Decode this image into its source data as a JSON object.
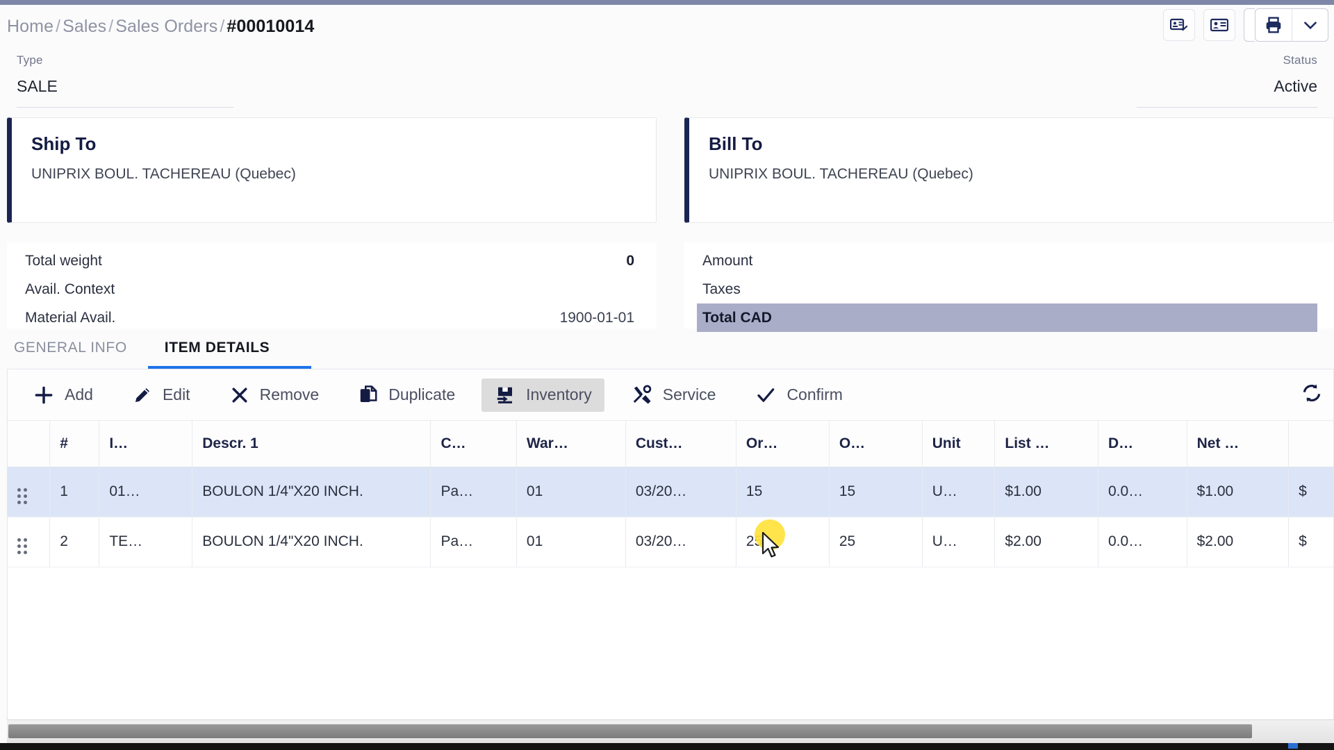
{
  "breadcrumb": {
    "items": [
      "Home",
      "Sales",
      "Sales Orders"
    ],
    "current": "#00010014",
    "separator": "/"
  },
  "header_actions": {
    "signature_button": "signature-icon",
    "contact_card_button": "contact-card-icon",
    "print_button": "printer-icon",
    "print_dropdown": "chevron-down-icon"
  },
  "fields": {
    "type_label": "Type",
    "type_value": "SALE",
    "status_label": "Status",
    "status_value": "Active"
  },
  "ship_to": {
    "title": "Ship To",
    "address": "UNIPRIX BOUL. TACHEREAU (Quebec)"
  },
  "bill_to": {
    "title": "Bill To",
    "address": "UNIPRIX BOUL. TACHEREAU (Quebec)"
  },
  "left_summary": {
    "rows": [
      {
        "label": "Total weight",
        "value": "0"
      },
      {
        "label": "Avail. Context",
        "value": ""
      },
      {
        "label": "Material Avail.",
        "value": "1900-01-01"
      }
    ]
  },
  "right_summary": {
    "rows": [
      {
        "label": "Amount",
        "value": ""
      },
      {
        "label": "Taxes",
        "value": ""
      },
      {
        "label": "Total CAD",
        "value": ""
      }
    ],
    "highlight_color": "#a9adc8"
  },
  "tabs": [
    {
      "label": "GENERAL INFO",
      "active": false
    },
    {
      "label": "ITEM DETAILS",
      "active": true
    }
  ],
  "toolbar": {
    "buttons": [
      {
        "label": "Add",
        "icon": "plus-icon",
        "active": false
      },
      {
        "label": "Edit",
        "icon": "pencil-icon",
        "active": false
      },
      {
        "label": "Remove",
        "icon": "x-icon",
        "active": false
      },
      {
        "label": "Duplicate",
        "icon": "copy-icon",
        "active": false
      },
      {
        "label": "Inventory",
        "icon": "save-box-icon",
        "active": true
      },
      {
        "label": "Service",
        "icon": "tools-icon",
        "active": false
      },
      {
        "label": "Confirm",
        "icon": "check-icon",
        "active": false
      }
    ],
    "refresh_icon": "refresh-icon"
  },
  "grid": {
    "columns": [
      "#",
      "I…",
      "Descr. 1",
      "C…",
      "War…",
      "Cust…",
      "Or…",
      "O…",
      "Unit",
      "List …",
      "D…",
      "Net …",
      ""
    ],
    "rows": [
      {
        "selected": true,
        "num": "1",
        "item": "01…",
        "descr": "BOULON 1/4\"X20 INCH.",
        "cust_col": "Pa…",
        "warehouse": "01",
        "cust_date": "03/20…",
        "ordered": "15",
        "open": "15",
        "unit": "U…",
        "list_price": "$1.00",
        "discount": "0.0…",
        "net_price": "$1.00",
        "amount": "$"
      },
      {
        "selected": false,
        "num": "2",
        "item": "TE…",
        "descr": "BOULON 1/4\"X20 INCH.",
        "cust_col": "Pa…",
        "warehouse": "01",
        "cust_date": "03/20…",
        "ordered": "25",
        "open": "25",
        "unit": "U…",
        "list_price": "$2.00",
        "discount": "0.0…",
        "net_price": "$2.00",
        "amount": "$"
      }
    ]
  },
  "colors": {
    "accent_navy": "#1b2453",
    "tab_underline": "#1e73e8",
    "row_selected": "#dbe5f7",
    "total_highlight": "#a9adc8",
    "click_highlight": "#ffe23c",
    "top_strip": "#7e87a8"
  }
}
